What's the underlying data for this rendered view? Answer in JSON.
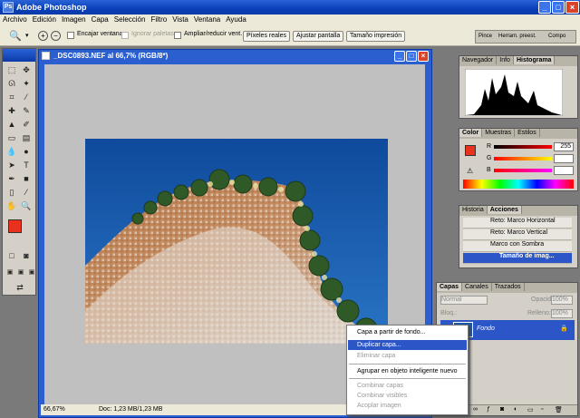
{
  "app": {
    "title": "Adobe Photoshop"
  },
  "menu": [
    "Archivo",
    "Edición",
    "Imagen",
    "Capa",
    "Selección",
    "Filtro",
    "Vista",
    "Ventana",
    "Ayuda"
  ],
  "options": {
    "resize_window": "Encajar ventana",
    "ignore_palettes": "Ignorar paletas",
    "zoom_all": "Ampliar/reducir vent.",
    "actual_pixels": "Píxeles reales",
    "fit_screen": "Ajustar pantalla",
    "print_size": "Tamaño impresión",
    "palette_well": [
      "Pince",
      "Herram. preest.",
      "Compo"
    ]
  },
  "document": {
    "title": "_DSC0893.NEF al 66,7% (RGB/8*)",
    "zoom": "66,67%",
    "doc_info": "Doc: 1,23 MB/1,23 MB"
  },
  "navigator": {
    "tabs": [
      "Navegador",
      "Info",
      "Histograma"
    ],
    "active": "Histograma"
  },
  "color": {
    "tabs": [
      "Color",
      "Muestras",
      "Estilos"
    ],
    "r_label": "R",
    "r_value": "255",
    "g_label": "G",
    "g_value": "",
    "b_label": "B",
    "b_value": "",
    "fg": "#e8321e"
  },
  "actions": {
    "tabs": [
      "Historia",
      "Acciones"
    ],
    "items": [
      "Reto: Marco Horizontal",
      "Reto: Marco Vertical",
      "Marco con Sombra",
      "Tamaño de imag..."
    ]
  },
  "layers": {
    "tabs": [
      "Capas",
      "Canales",
      "Trazados"
    ],
    "mode": "Normal",
    "opacity_label": "Opacidad:",
    "opacity_value": "100%",
    "lock_label": "Bloq.:",
    "fill_label": "Relleno:",
    "fill_value": "100%",
    "layer_name": "Fondo"
  },
  "context_menu": {
    "items": [
      {
        "label": "Capa a partir de fondo...",
        "state": "normal"
      },
      {
        "label": "Duplicar capa...",
        "state": "selected"
      },
      {
        "label": "Eliminar capa",
        "state": "disabled"
      },
      {
        "label": "Agrupar en objeto inteligente nuevo",
        "state": "normal"
      },
      {
        "label": "Combinar capas",
        "state": "disabled"
      },
      {
        "label": "Combinar visibles",
        "state": "disabled"
      },
      {
        "label": "Acoplar imagen",
        "state": "disabled"
      }
    ]
  }
}
